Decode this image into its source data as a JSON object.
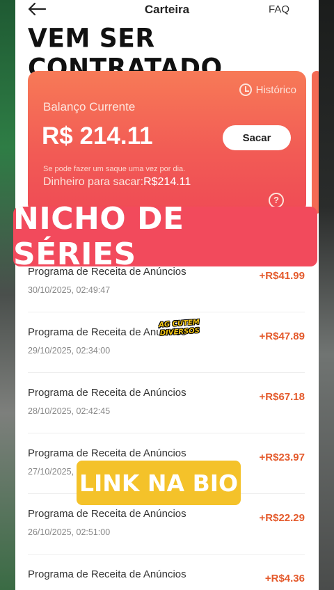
{
  "header": {
    "title": "Carteira",
    "faq_label": "FAQ",
    "back_icon": "back-arrow-icon"
  },
  "overlays": {
    "top_caption": "VEM SER CONTRATADO",
    "series_banner": "NICHO DE SÉRIES",
    "link_banner": "LINK NA BIO",
    "watermark": "AG CUTEM DIVERSOS"
  },
  "balance_card": {
    "history_label": "Histórico",
    "balance_label": "Balanço Currente",
    "balance_amount": "R$ 214.11",
    "withdraw_label": "Sacar",
    "note": "Se pode fazer um saque uma vez por dia.",
    "available_label": "Dinheiro para sacar:",
    "available_amount": "R$214.11",
    "help_icon": "question-circle-icon",
    "colors": {
      "gradient_top": "#f77a57",
      "gradient_bottom": "#ef4b55"
    }
  },
  "transactions": [
    {
      "title": "Programa de Receita de Anúncios",
      "date": "30/10/2025, 02:49:47",
      "amount": "+R$41.99"
    },
    {
      "title": "Programa de Receita de Anúncios",
      "date": "29/10/2025, 02:34:00",
      "amount": "+R$47.89"
    },
    {
      "title": "Programa de Receita de Anúncios",
      "date": "28/10/2025, 02:42:45",
      "amount": "+R$67.18"
    },
    {
      "title": "Programa de Receita de Anúncios",
      "date": "27/10/2025,",
      "amount": "+R$23.97"
    },
    {
      "title": "Programa de Receita de Anúncios",
      "date": "26/10/2025, 02:51:00",
      "amount": "+R$22.29"
    },
    {
      "title": "Programa de Receita de Anúncios",
      "date": "",
      "amount": "+R$4.36"
    }
  ],
  "colors": {
    "amount_positive": "#e45a2c",
    "series_banner_bg": "#f24a5c",
    "link_banner_bg": "#f4c22a"
  }
}
